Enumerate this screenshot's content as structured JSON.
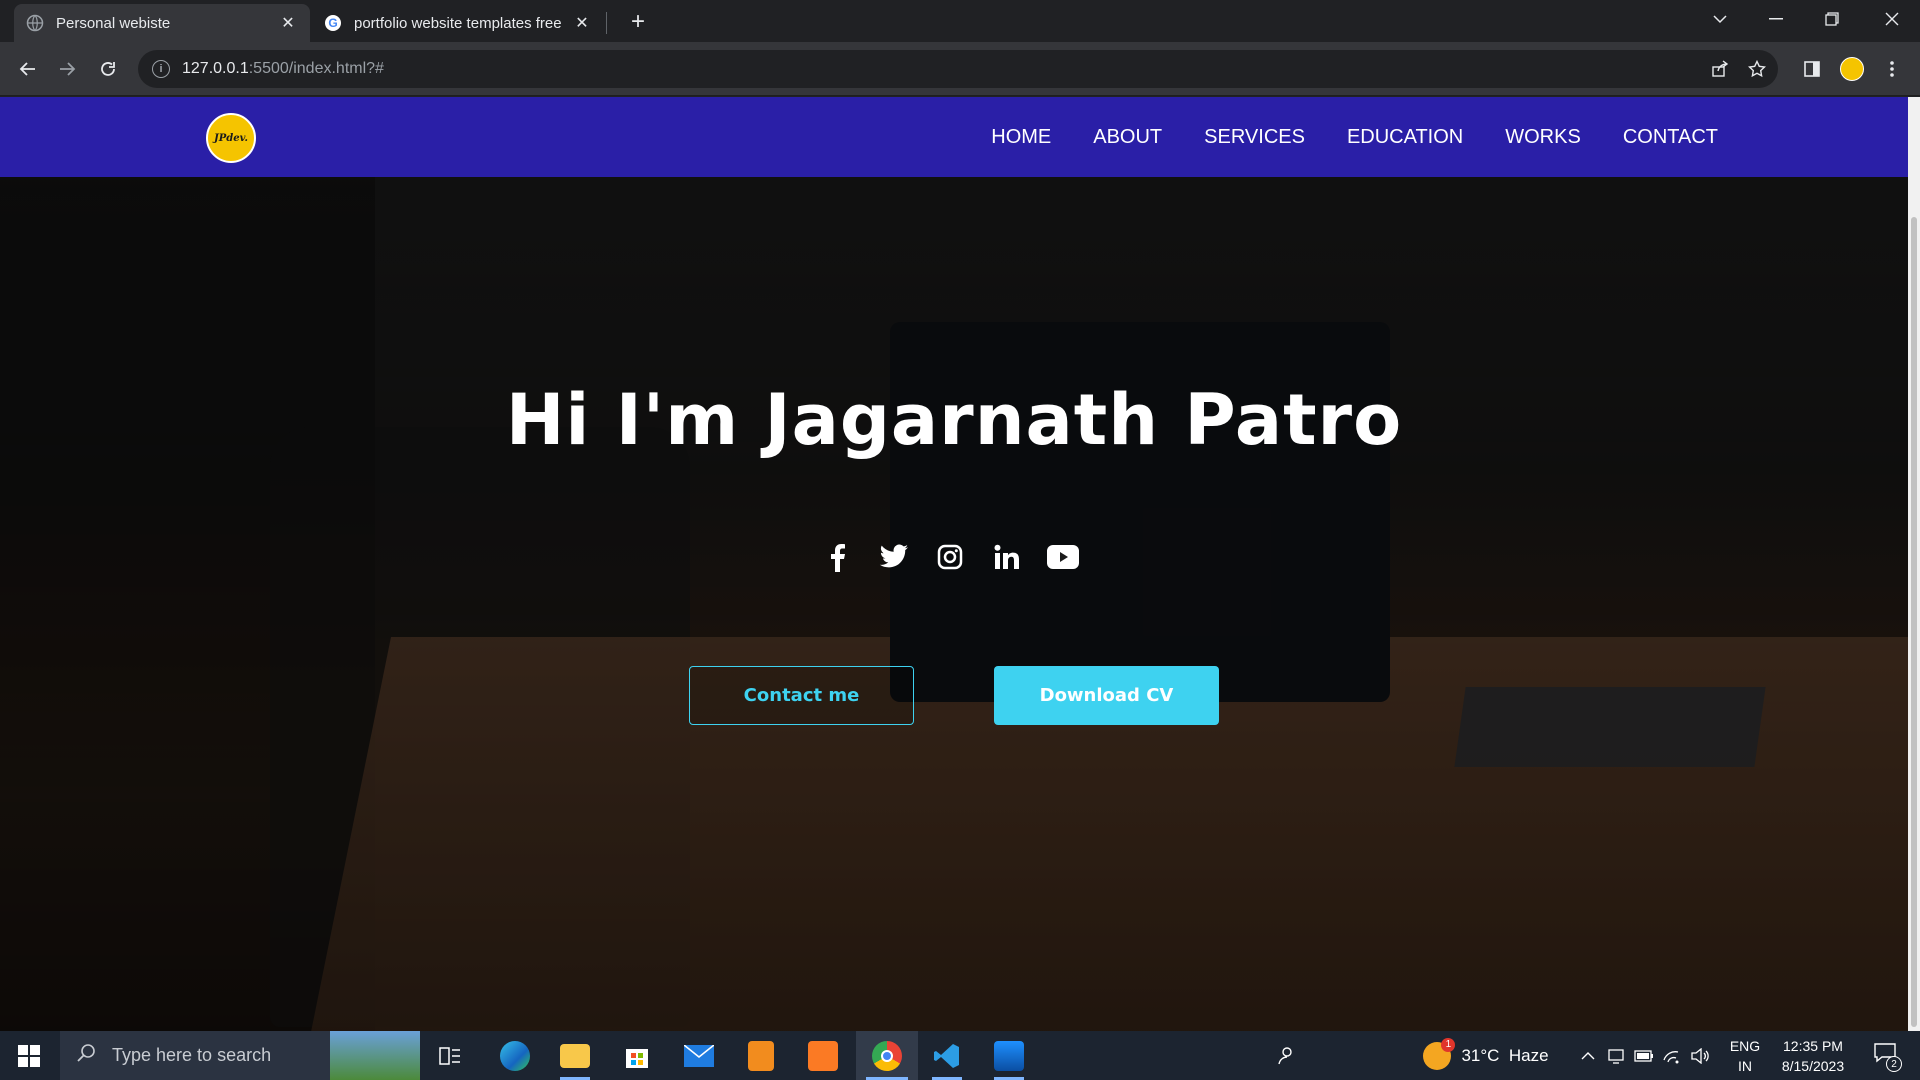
{
  "browser": {
    "tabs": [
      {
        "title": "Personal webiste",
        "active": true
      },
      {
        "title": "portfolio website templates free",
        "active": false
      }
    ],
    "url_host": "127.0.0.1",
    "url_rest": ":5500/index.html?#"
  },
  "site": {
    "logo_text": "JPdev.",
    "nav": [
      "HOME",
      "ABOUT",
      "SERVICES",
      "EDUCATION",
      "WORKS",
      "CONTACT"
    ],
    "hero_title": "Hi I'm Jagarnath Patro",
    "socials": [
      "facebook-icon",
      "twitter-icon",
      "instagram-icon",
      "linkedin-icon",
      "youtube-icon"
    ],
    "buttons": {
      "contact": "Contact me",
      "download": "Download CV"
    },
    "colors": {
      "nav_bg": "#2a1fa7",
      "accent": "#3ed2f0",
      "logo": "#f5c400"
    }
  },
  "taskbar": {
    "search_placeholder": "Type here to search",
    "weather": "31°C  Haze",
    "weather_badge": "1",
    "lang_top": "ENG",
    "lang_bottom": "IN",
    "time": "12:35 PM",
    "date": "8/15/2023",
    "notifications": "2"
  }
}
